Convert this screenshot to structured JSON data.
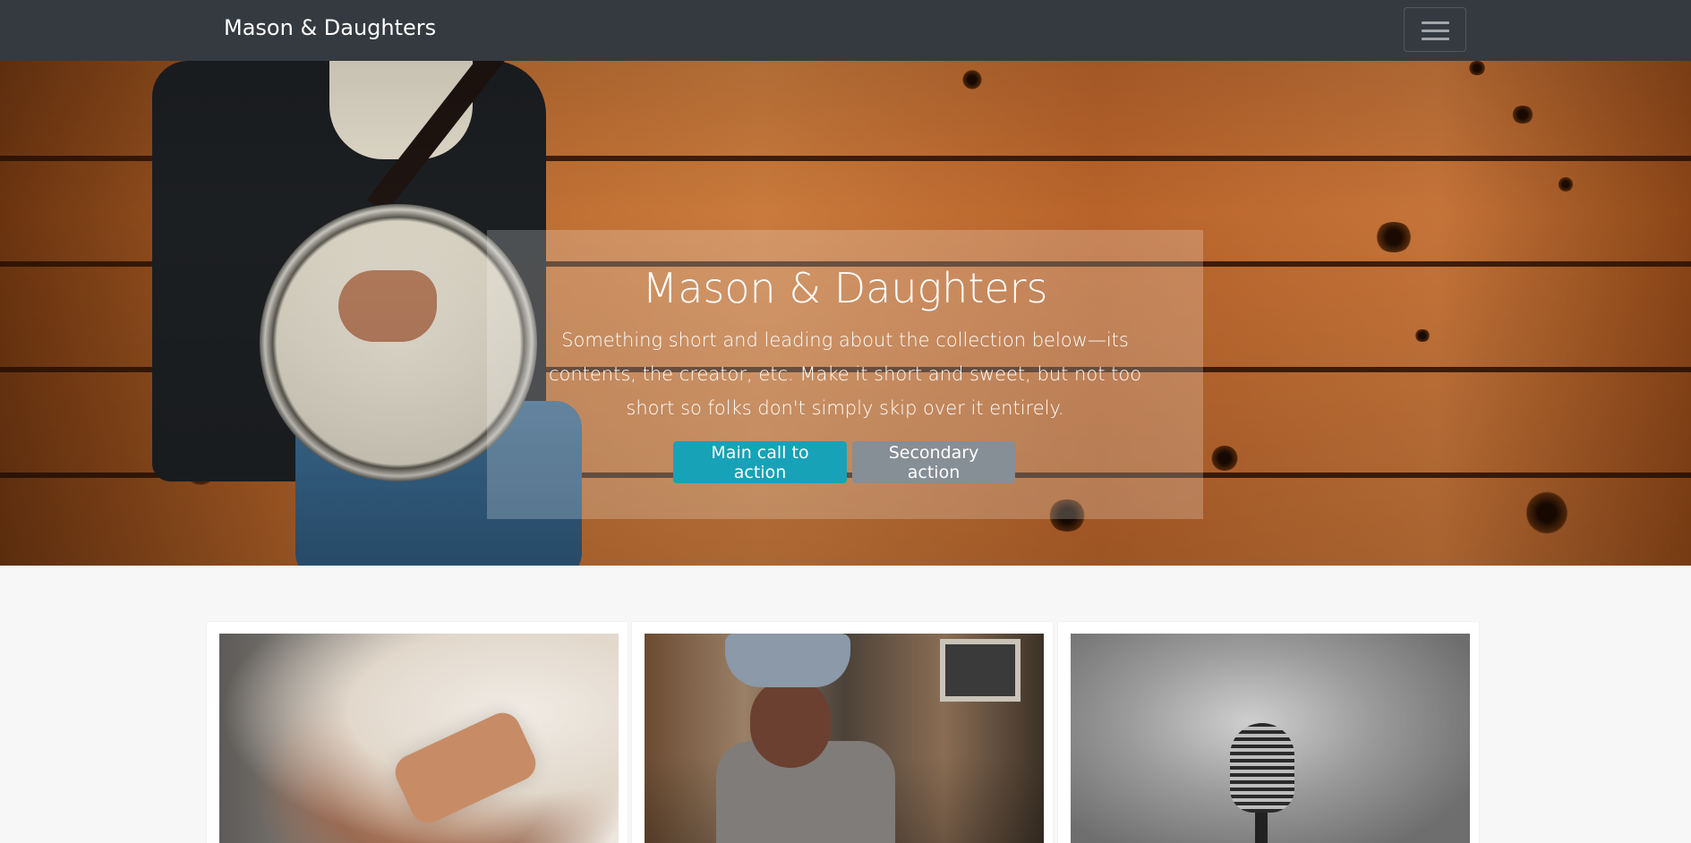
{
  "navbar": {
    "brand": "Mason & Daughters",
    "toggler_icon": "hamburger-menu-icon"
  },
  "hero": {
    "title": "Mason & Daughters",
    "lead": "Something short and leading about the collection below—its contents, the creator, etc. Make it short and sweet, but not too short so folks don't simply skip over it entirely.",
    "primary_button": "Main call to action",
    "secondary_button": "Secondary action",
    "background_image": "banjo-player-wood-wall-photo"
  },
  "cards": [
    {
      "image": "guitarist-close-up-photo"
    },
    {
      "image": "woman-with-guitar-in-record-store-photo"
    },
    {
      "image": "vintage-microphone-photo"
    }
  ],
  "colors": {
    "navbar_bg": "#343a40",
    "primary": "#17a2b8",
    "secondary": "#868e96",
    "page_bg": "#f7f7f7"
  }
}
